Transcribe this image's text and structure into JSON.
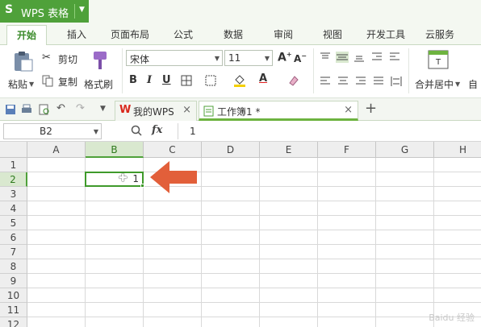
{
  "app": {
    "logo": "S",
    "name": "WPS 表格"
  },
  "ribbon_tabs": [
    "开始",
    "插入",
    "页面布局",
    "公式",
    "数据",
    "审阅",
    "视图",
    "开发工具",
    "云服务"
  ],
  "clipboard": {
    "paste": "粘贴",
    "cut": "剪切",
    "copy": "复制",
    "format_painter": "格式刷"
  },
  "font": {
    "family": "宋体",
    "size": "11",
    "bold": "B",
    "italic": "I",
    "underline": "U"
  },
  "merge": {
    "merge_center": "合并居中",
    "auto_wrap": "自"
  },
  "doc_tabs": [
    {
      "label": "我的WPS",
      "close": "×"
    },
    {
      "label": "工作簿1 *",
      "close": "×"
    }
  ],
  "new_tab": "+",
  "formula_bar": {
    "name_box": "B2",
    "fx": "fx",
    "value": "1"
  },
  "columns": [
    "A",
    "B",
    "C",
    "D",
    "E",
    "F",
    "G",
    "H"
  ],
  "rows": [
    "1",
    "2",
    "3",
    "4",
    "5",
    "6",
    "7",
    "8",
    "9",
    "10",
    "11",
    "12"
  ],
  "selected": {
    "column": "B",
    "row": "2",
    "value": "1"
  },
  "watermark": "Baidu 经验",
  "colors": {
    "accent": "#4fa13a",
    "arrow": "#e25f3a"
  }
}
